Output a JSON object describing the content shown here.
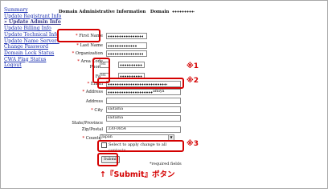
{
  "sidebar": {
    "items": [
      {
        "label": "Summary"
      },
      {
        "label": "Update Registrant Info"
      },
      {
        "label": "» Update Admin Info"
      },
      {
        "label": "Update Billing Info"
      },
      {
        "label": "Update Technical Info"
      },
      {
        "label": "Update Name Servers"
      },
      {
        "label": "Change Password"
      },
      {
        "label": "Domain Lock Status"
      },
      {
        "label": "CWA Flag Status"
      },
      {
        "label": "Logout"
      }
    ]
  },
  "header": {
    "title": "Domain Administrative Information",
    "domain_label": "Domain"
  },
  "form": {
    "first_name_label": "First Name",
    "last_name_label": "Last Name",
    "organization_label": "Organization",
    "area_code_label": "Area Code",
    "phone_label": "Phone",
    "phone_area_code": "81",
    "fax_label": "Fax",
    "fax_area_code": "81",
    "email_label": "Email",
    "address_label": "Address",
    "address_value_suffix": "amiya",
    "address2_label": "Address",
    "city_label": "City",
    "city_value": "saitama",
    "state_label": "State/Province",
    "state_value": "saitama",
    "zip_label": "Zip/Postal",
    "zip_value": "330-0854",
    "country_label": "Country",
    "country_value": "Japan",
    "apply_all_label": "Select to apply change to all",
    "apply_all_sub": "contacts",
    "submit_label": "Submit",
    "required_note": "*required fields",
    "required_marker": "*"
  },
  "annotations": {
    "mark1": "※1",
    "mark2": "※2",
    "mark3": "※3",
    "submit_note": "↑『Submit』ボタン",
    "accent_color": "#d40000"
  }
}
